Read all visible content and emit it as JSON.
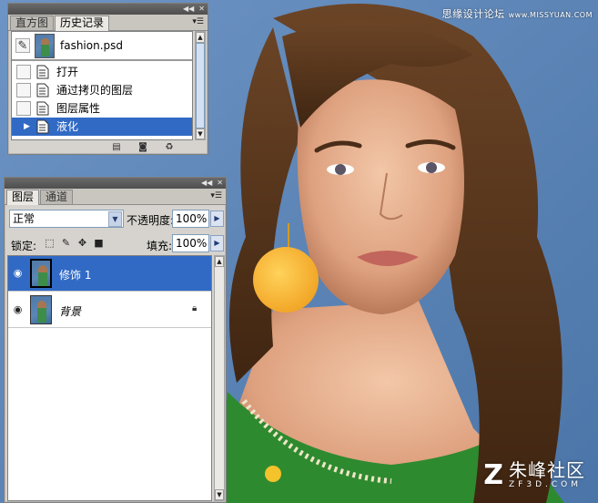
{
  "watermark": {
    "site_cn": "思缘设计论坛",
    "site_domain": "www.MISSYUAN.COM"
  },
  "brand": {
    "logo_glyph": "Z",
    "name_cn": "朱峰社区",
    "domain": "ZF3D.COM"
  },
  "history_panel": {
    "tabs": [
      "直方图",
      "历史记录"
    ],
    "active_tab": "历史记录",
    "snapshot": {
      "name": "fashion.psd"
    },
    "steps": [
      {
        "label": "打开",
        "selected": false
      },
      {
        "label": "通过拷贝的图层",
        "selected": false
      },
      {
        "label": "图层属性",
        "selected": false
      },
      {
        "label": "液化",
        "selected": true
      }
    ],
    "footer_icons": [
      "new-document-from-state-icon",
      "camera-snapshot-icon",
      "trash-icon"
    ]
  },
  "layers_panel": {
    "tabs": [
      "图层",
      "通道"
    ],
    "active_tab": "图层",
    "blend_mode": "正常",
    "opacity_label": "不透明度:",
    "opacity": "100%",
    "lock_label": "锁定:",
    "fill_label": "填充:",
    "fill": "100%",
    "layers": [
      {
        "name": "修饰 1",
        "visible": true,
        "selected": true,
        "locked": false
      },
      {
        "name": "背景",
        "visible": true,
        "selected": false,
        "locked": true
      }
    ]
  },
  "colors": {
    "selection": "#316ac5",
    "panel_bg": "#d6d3ce",
    "photo_bg": "#5b83b3"
  }
}
